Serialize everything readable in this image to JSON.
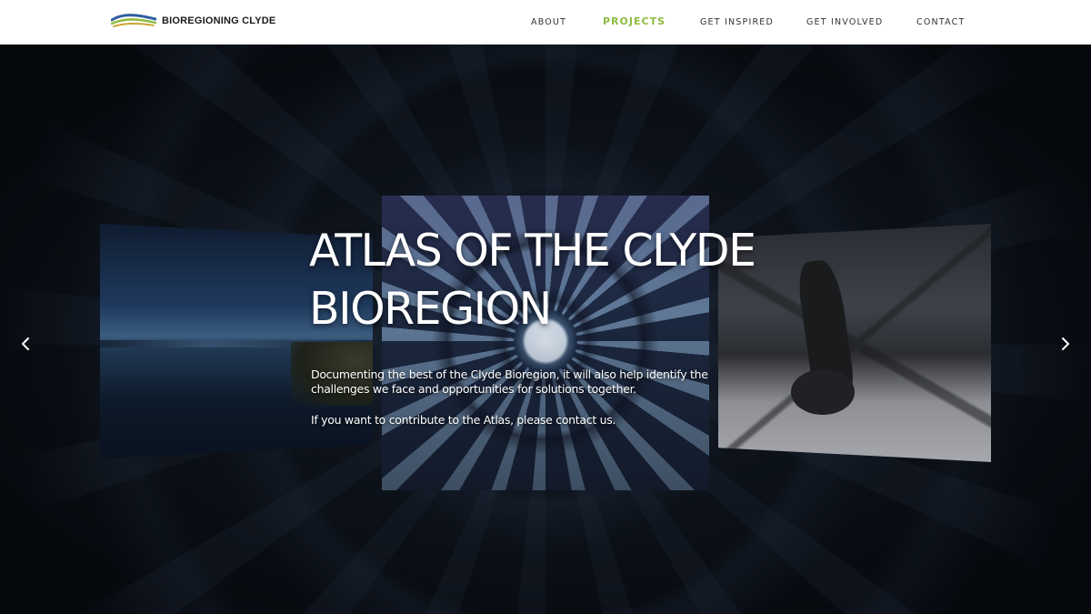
{
  "brand": {
    "name": "BIOREGIONING CLYDE",
    "logo_colors": [
      "#2f5fa0",
      "#8dbb3e",
      "#c9a227"
    ]
  },
  "nav": {
    "items": [
      {
        "label": "ABOUT",
        "active": false
      },
      {
        "label": "PROJECTS",
        "active": true
      },
      {
        "label": "GET INSPIRED",
        "active": false
      },
      {
        "label": "GET INVOLVED",
        "active": false
      },
      {
        "label": "CONTACT",
        "active": false
      }
    ],
    "active_color": "#8dbb3e"
  },
  "hero": {
    "title_line1": "ATLAS OF THE CLYDE",
    "title_line2": "BIOREGION",
    "description": "Documenting the best of the Clyde Bioregion, it will also help identify the challenges we face and opportunities for solutions together.",
    "contact_line": "If you want to contribute to the Atlas, please contact us.",
    "prev_icon": "chevron-left-icon",
    "next_icon": "chevron-right-icon"
  }
}
